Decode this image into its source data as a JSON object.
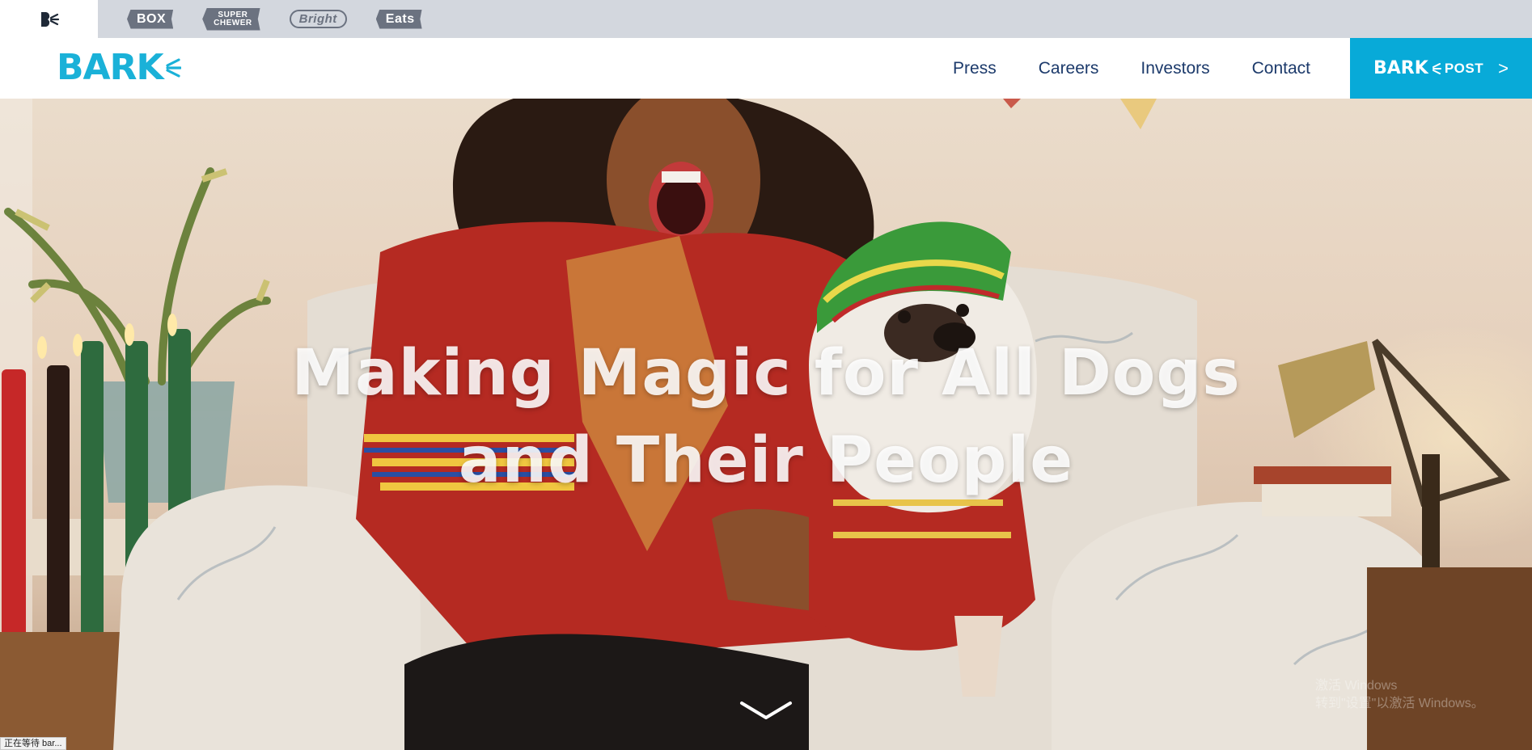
{
  "brand_bar": {
    "active_brand_icon": "bark-mini-logo-icon",
    "brands": [
      {
        "label": "BOX"
      },
      {
        "label": "SUPER CHEWER",
        "line1": "SUPER",
        "line2": "CHEWER"
      },
      {
        "label": "Bright"
      },
      {
        "label": "Eats"
      }
    ]
  },
  "nav": {
    "logo_text": "BARK",
    "links": [
      "Press",
      "Careers",
      "Investors",
      "Contact"
    ],
    "cta": {
      "brand": "BARK",
      "label": "POST",
      "chevron": ">"
    }
  },
  "hero": {
    "title_line1": "Making Magic for All Dogs",
    "title_line2": "and Their People",
    "scroll_icon": "chevron-down-icon"
  },
  "os_overlay": {
    "watermark_line1": "激活 Windows",
    "watermark_line2": "转到\"设置\"以激活 Windows。",
    "status_text": "正在等待 bar..."
  },
  "colors": {
    "brand_blue": "#1ab1d8",
    "cta_blue": "#08aad8",
    "nav_text": "#1c3a6b",
    "strip_bg": "#d3d7de"
  }
}
